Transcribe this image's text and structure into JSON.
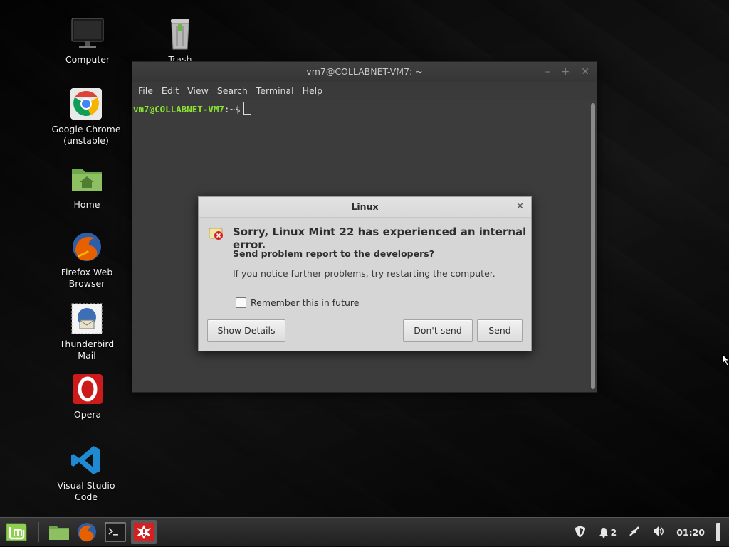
{
  "desktop_icons": [
    {
      "id": "computer",
      "label": "Computer"
    },
    {
      "id": "trash",
      "label": "Trash"
    },
    {
      "id": "chrome",
      "label": "Google Chrome (unstable)"
    },
    {
      "id": "home",
      "label": "Home"
    },
    {
      "id": "firefox",
      "label": "Firefox Web Browser"
    },
    {
      "id": "thunderbird",
      "label": "Thunderbird Mail"
    },
    {
      "id": "opera",
      "label": "Opera"
    },
    {
      "id": "vscode",
      "label": "Visual Studio Code"
    }
  ],
  "terminal": {
    "title": "vm7@COLLABNET-VM7: ~",
    "menu": [
      "File",
      "Edit",
      "View",
      "Search",
      "Terminal",
      "Help"
    ],
    "prompt_user": "vm7@COLLABNET-VM7",
    "prompt_path": ":~$"
  },
  "dialog": {
    "title": "Linux",
    "heading": "Sorry, Linux Mint 22 has experienced an internal error.",
    "subheading": "Send problem report to the developers?",
    "body": "If you notice further problems, try restarting the computer.",
    "remember_label": "Remember this in future",
    "remember_checked": false,
    "show_details": "Show Details",
    "dont_send": "Don't send",
    "send": "Send"
  },
  "taskbar": {
    "notification_count": "2",
    "clock": "01:20"
  },
  "colors": {
    "prompt_user": "#8ae234",
    "dialog_bg": "#d6d6d6",
    "terminal_bg": "#3c3c3c"
  }
}
